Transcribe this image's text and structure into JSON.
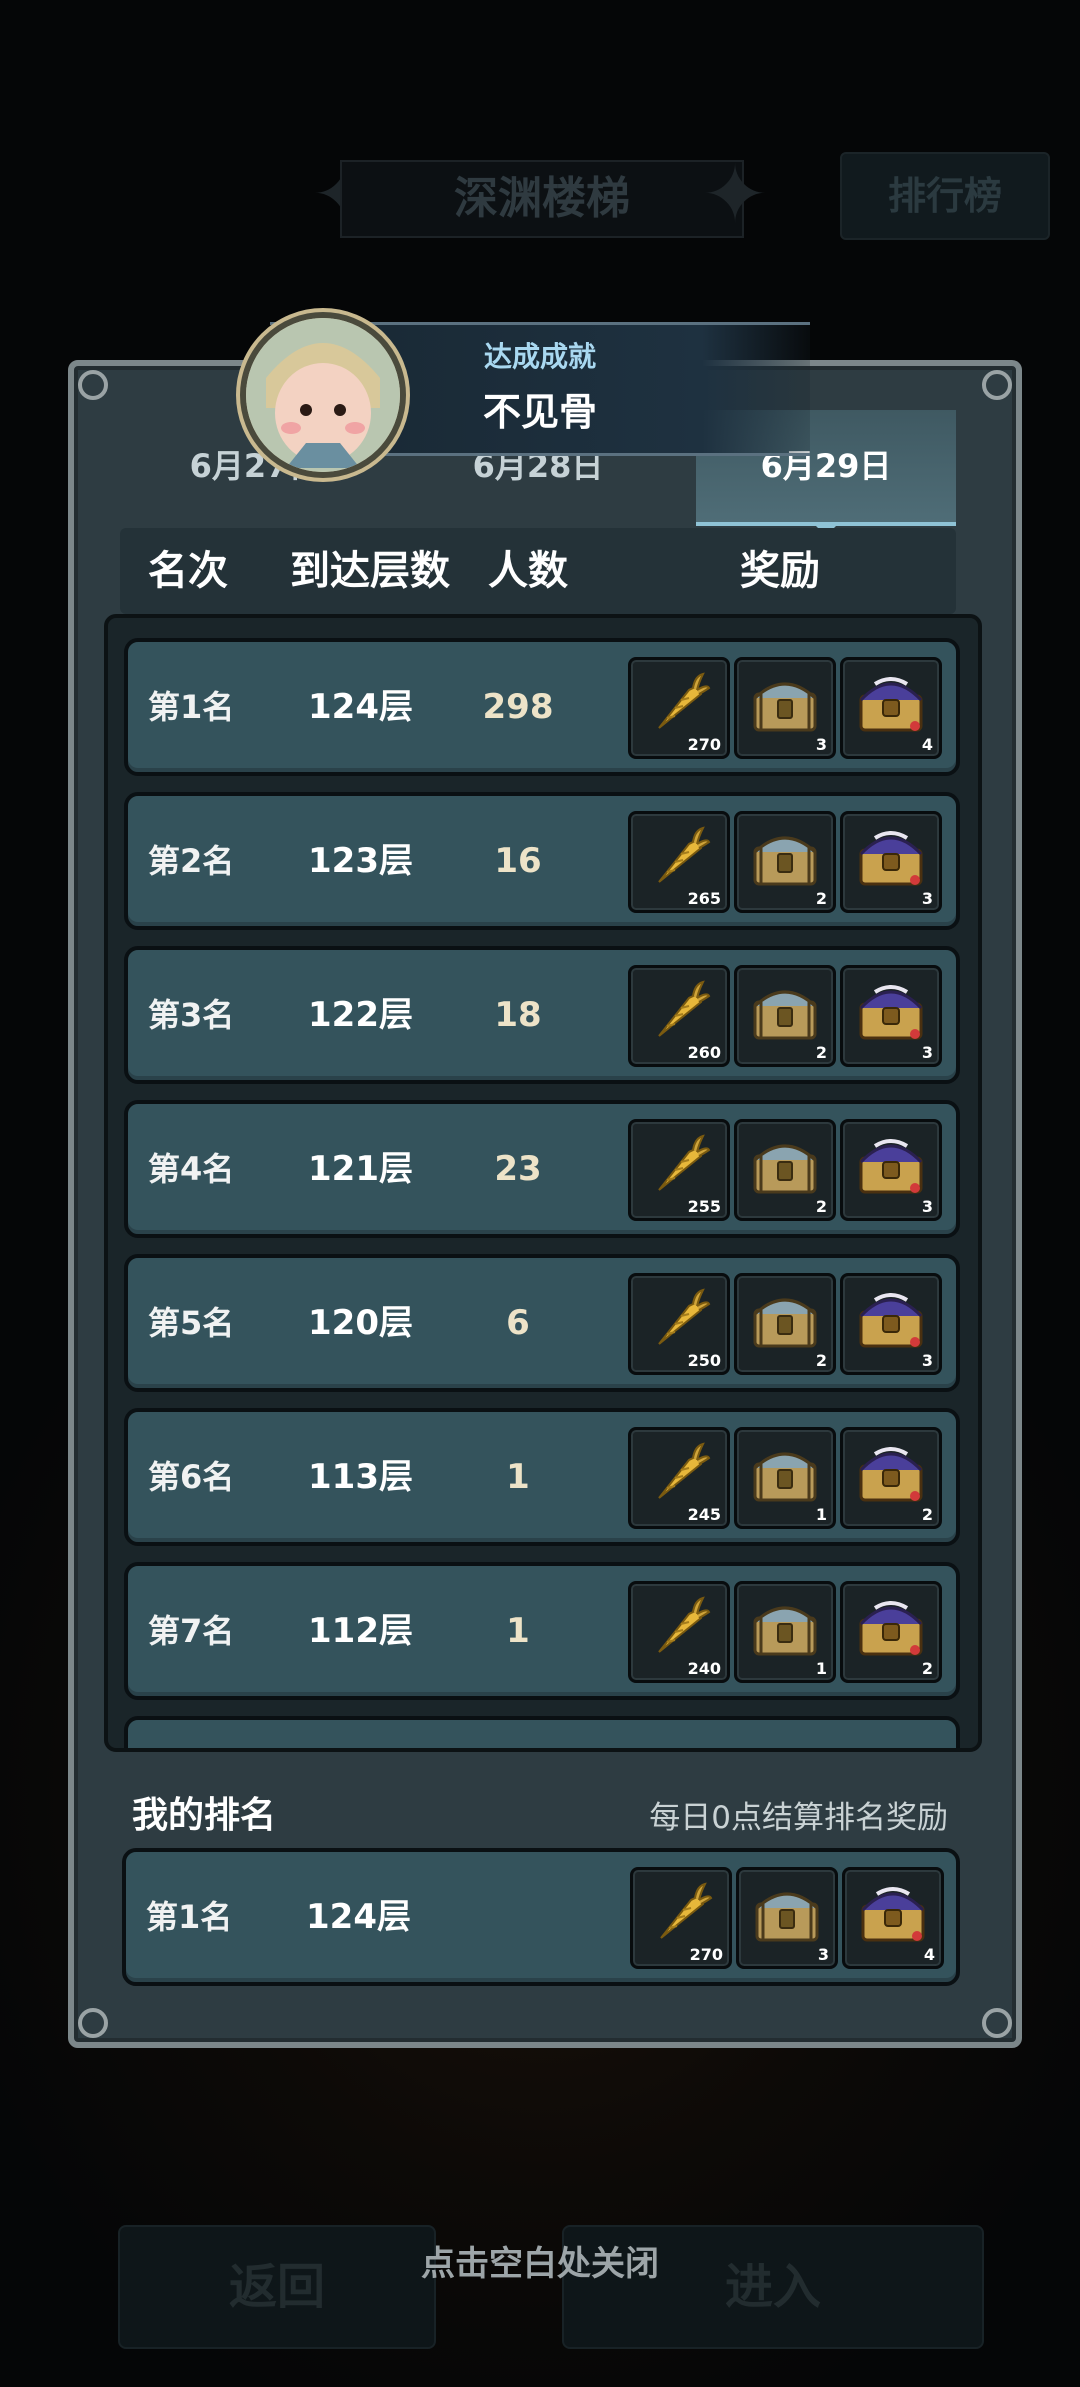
{
  "background": {
    "title": "深渊楼梯",
    "rank_button": "排行榜",
    "back_button": "返回",
    "enter_button": "进入"
  },
  "achievement": {
    "title": "达成成就",
    "name": "不见骨"
  },
  "tabs": [
    {
      "label": "6月27日"
    },
    {
      "label": "6月28日"
    },
    {
      "label": "6月29日"
    }
  ],
  "columns": {
    "rank": "名次",
    "floor": "到达层数",
    "count": "人数",
    "reward": "奖励"
  },
  "rows": [
    {
      "rank": "第1名",
      "floor": "124层",
      "count": "298",
      "rewards": [
        "270",
        "3",
        "4"
      ]
    },
    {
      "rank": "第2名",
      "floor": "123层",
      "count": "16",
      "rewards": [
        "265",
        "2",
        "3"
      ]
    },
    {
      "rank": "第3名",
      "floor": "122层",
      "count": "18",
      "rewards": [
        "260",
        "2",
        "3"
      ]
    },
    {
      "rank": "第4名",
      "floor": "121层",
      "count": "23",
      "rewards": [
        "255",
        "2",
        "3"
      ]
    },
    {
      "rank": "第5名",
      "floor": "120层",
      "count": "6",
      "rewards": [
        "250",
        "2",
        "3"
      ]
    },
    {
      "rank": "第6名",
      "floor": "113层",
      "count": "1",
      "rewards": [
        "245",
        "1",
        "2"
      ]
    },
    {
      "rank": "第7名",
      "floor": "112层",
      "count": "1",
      "rewards": [
        "240",
        "1",
        "2"
      ]
    }
  ],
  "reward_icons": [
    "carrot-icon",
    "bronze-chest-icon",
    "purple-chest-icon"
  ],
  "my_rank": {
    "label": "我的排名",
    "note": "每日0点结算排名奖励",
    "rank": "第1名",
    "floor": "124层",
    "rewards": [
      "270",
      "3",
      "4"
    ]
  },
  "close_hint": "点击空白处关闭",
  "colors": {
    "panel": "#2e3c42",
    "row": "#34535c",
    "accent": "#8fc3d6"
  }
}
